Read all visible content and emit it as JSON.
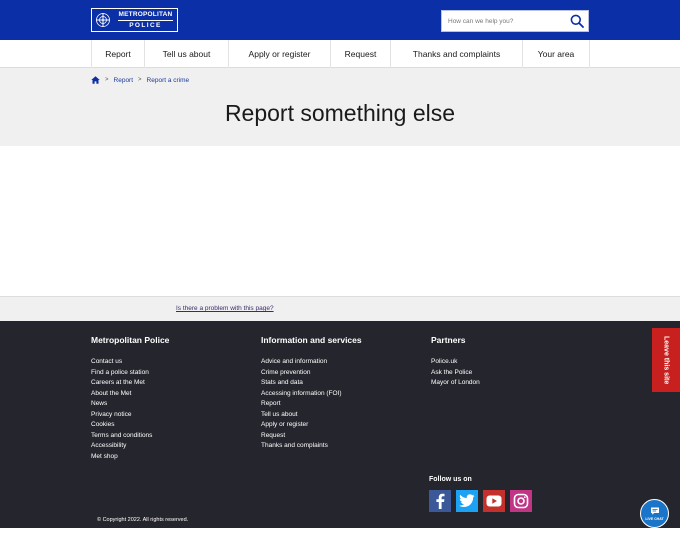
{
  "header": {
    "logo": {
      "line1": "METROPOLITAN",
      "line2": "POLICE"
    },
    "search": {
      "placeholder": "How can we help you?",
      "icon": "search-icon"
    },
    "colors": {
      "brand": "#0a2fa6"
    }
  },
  "nav": {
    "items": [
      {
        "label": "Report"
      },
      {
        "label": "Tell us about"
      },
      {
        "label": "Apply or register"
      },
      {
        "label": "Request"
      },
      {
        "label": "Thanks and complaints"
      },
      {
        "label": "Your area"
      }
    ]
  },
  "breadcrumb": {
    "home_icon": "home-icon",
    "sep": ">",
    "items": [
      {
        "label": "Report"
      },
      {
        "label": "Report a crime"
      }
    ]
  },
  "page": {
    "title": "Report something else"
  },
  "problem": {
    "link": "Is there a problem with this page?"
  },
  "footer": {
    "columns": [
      {
        "title": "Metropolitan Police",
        "links": [
          "Contact us",
          "Find a police station",
          "Careers at the Met",
          "About the Met",
          "News",
          "Privacy notice",
          "Cookies",
          "Terms and conditions",
          "Accessibility",
          "Met shop"
        ]
      },
      {
        "title": "Information and services",
        "links": [
          "Advice and information",
          "Crime prevention",
          "Stats and data",
          "Accessing information (FOI)",
          "Report",
          "Tell us about",
          "Apply or register",
          "Request",
          "Thanks and complaints"
        ]
      },
      {
        "title": "Partners",
        "links": [
          "Police.uk",
          "Ask the Police",
          "Mayor of London"
        ]
      }
    ],
    "follow": "Follow us on",
    "social": [
      {
        "icon": "facebook-icon",
        "color": "#3b5998"
      },
      {
        "icon": "twitter-icon",
        "color": "#1da1f2"
      },
      {
        "icon": "youtube-icon",
        "color": "#c4302b"
      },
      {
        "icon": "instagram-icon",
        "color": "#c13584"
      }
    ],
    "copyright": "© Copyright 2022. All rights reserved."
  },
  "leave_tab": {
    "label": "Leave this site",
    "color": "#c8201e"
  },
  "livechat": {
    "label": "LIVE CHAT",
    "color": "#1a74c8"
  }
}
